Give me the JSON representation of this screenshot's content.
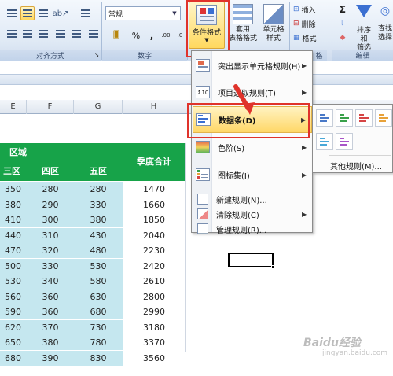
{
  "ribbon": {
    "groups": {
      "alignment": "对齐方式",
      "number": "数字",
      "styles_partial": "格",
      "editing": "编辑"
    },
    "number_format_value": "常规",
    "number_buttons": [
      "%",
      ","
    ],
    "conditional_format_label": "条件格式",
    "table_format_label": "套用\n表格格式",
    "cell_styles_label": "单元格\n样式",
    "insert_label": "插入",
    "delete_label": "删除",
    "format_label": "格式",
    "sort_filter_label": "排序和\n筛选",
    "find_select_label": "查找\n选择",
    "sigma": "Σ",
    "accent_color": "#e0332b"
  },
  "columns": [
    "E",
    "F",
    "G",
    "H"
  ],
  "table": {
    "region_header": "区域",
    "quarter_total_header": "季度合计",
    "sub_headers": [
      "三区",
      "四区",
      "五区"
    ],
    "rows": [
      [
        "350",
        "280",
        "280",
        "1470"
      ],
      [
        "380",
        "290",
        "330",
        "1660"
      ],
      [
        "410",
        "300",
        "380",
        "1850"
      ],
      [
        "440",
        "310",
        "430",
        "2040"
      ],
      [
        "470",
        "320",
        "480",
        "2230"
      ],
      [
        "500",
        "330",
        "530",
        "2420"
      ],
      [
        "530",
        "340",
        "580",
        "2610"
      ],
      [
        "560",
        "360",
        "630",
        "2800"
      ],
      [
        "590",
        "360",
        "680",
        "2990"
      ],
      [
        "620",
        "370",
        "730",
        "3180"
      ],
      [
        "650",
        "380",
        "780",
        "3370"
      ],
      [
        "680",
        "390",
        "830",
        "3560"
      ]
    ]
  },
  "menu": {
    "items": [
      {
        "label": "突出显示单元格规则(H)",
        "icon": "highlight-rules-icon",
        "submenu": true
      },
      {
        "label": "项目选取规则(T)",
        "icon": "top-bottom-rules-icon",
        "submenu": true
      },
      {
        "label": "数据条(D)",
        "icon": "data-bars-icon",
        "submenu": true,
        "selected": true
      },
      {
        "label": "色阶(S)",
        "icon": "color-scales-icon",
        "submenu": true
      },
      {
        "label": "图标集(I)",
        "icon": "icon-sets-icon",
        "submenu": true
      }
    ],
    "small_items": [
      {
        "label": "新建规则(N)...",
        "icon": "new-rule-icon"
      },
      {
        "label": "清除规则(C)",
        "icon": "clear-rules-icon",
        "submenu": true
      },
      {
        "label": "管理规则(R)...",
        "icon": "manage-rules-icon"
      }
    ]
  },
  "submenu": {
    "more_rules": "其他规则(M)...",
    "bar_colors": [
      "#4a79c7",
      "#3aa14a",
      "#d64545",
      "#e8a23a",
      "#4aa8d8",
      "#a855c8"
    ]
  },
  "watermark": {
    "text": "Baidu经验",
    "sub": "jingyan.baidu.com"
  }
}
